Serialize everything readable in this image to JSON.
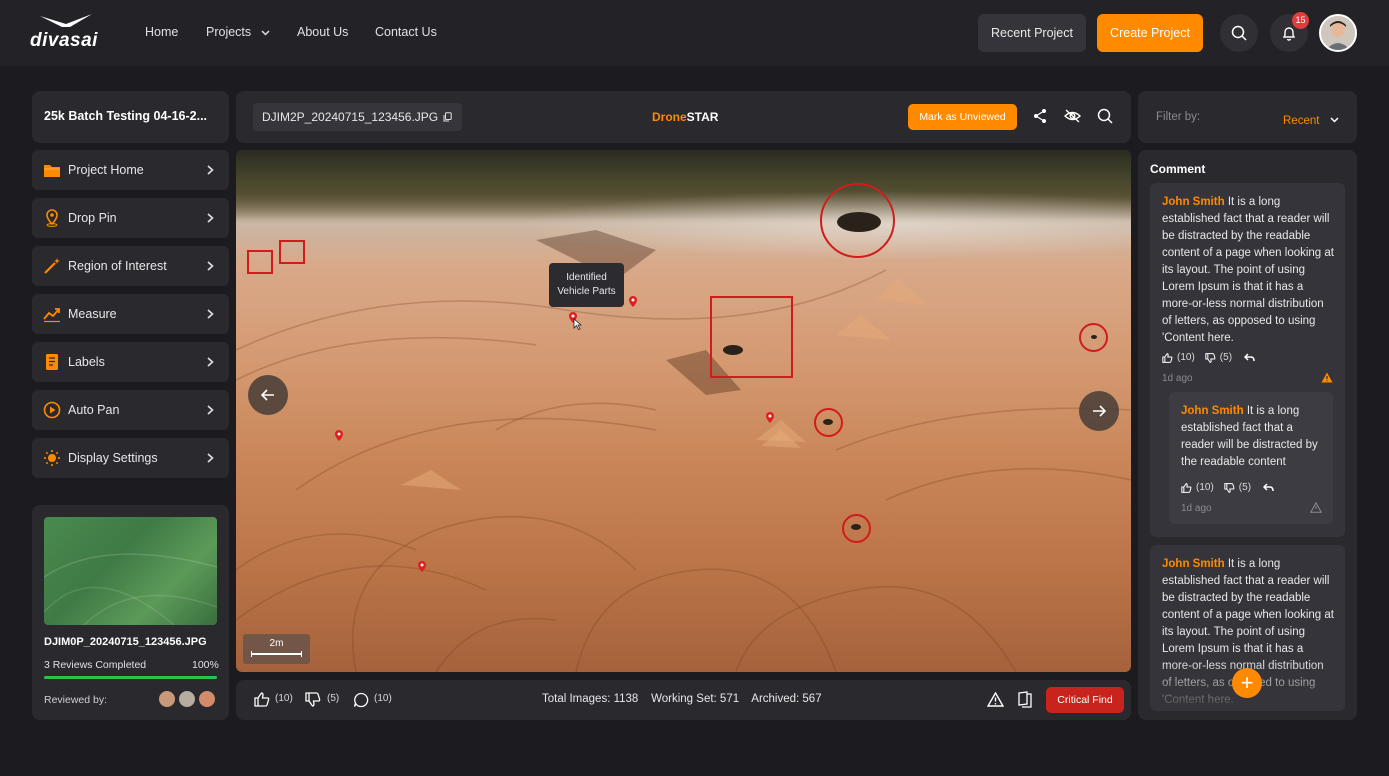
{
  "brand": {
    "name": "divasai"
  },
  "nav": {
    "home": "Home",
    "projects": "Projects",
    "about": "About Us",
    "contact": "Contact Us"
  },
  "header_actions": {
    "recent_project": "Recent Project",
    "create_project": "Create Project",
    "notification_count": "15"
  },
  "sidebar": {
    "project_title": "25k Batch Testing 04-16-2...",
    "items": [
      {
        "label": "Project Home",
        "icon": "folder-icon"
      },
      {
        "label": "Drop Pin",
        "icon": "drop-pin-icon"
      },
      {
        "label": "Region of Interest",
        "icon": "magic-wand-icon"
      },
      {
        "label": "Measure",
        "icon": "trend-icon"
      },
      {
        "label": "Labels",
        "icon": "labels-icon"
      },
      {
        "label": "Auto Pan",
        "icon": "play-icon"
      },
      {
        "label": "Display Settings",
        "icon": "sun-icon"
      }
    ],
    "preview": {
      "file_name": "DJIM0P_20240715_123456.JPG",
      "reviews_label": "3 Reviews Completed",
      "reviews_percent": "100%",
      "progress": 1.0,
      "reviewed_by_label": "Reviewed by:"
    }
  },
  "viewer": {
    "file_name": "DJIM2P_20240715_123456.JPG",
    "title_prefix": "Drone",
    "title_suffix": "STAR",
    "mark_unviewed": "Mark as Unviewed",
    "tooltip": "Identified Vehicle Parts",
    "scale_label": "2m"
  },
  "footer": {
    "likes": "(10)",
    "dislikes": "(5)",
    "comments": "(10)",
    "total_images": "Total Images: 1138",
    "working_set": "Working Set: 571",
    "archived": "Archived: 567",
    "critical_find": "Critical Find"
  },
  "comments_panel": {
    "filter_label": "Filter by:",
    "filter_value": "Recent",
    "title": "Comment",
    "comments": [
      {
        "author": "John Smith",
        "text": " It is a long established fact that a reader will be distracted by the readable content of a page when looking at its layout. The point of using Lorem Ipsum is that it has a more-or-less normal distribution of letters, as opposed to using 'Content here.",
        "likes": "(10)",
        "dislikes": "(5)",
        "time": "1d ago"
      },
      {
        "author": "John Smith",
        "text": " It is a long established fact that a reader will be distracted by the readable content",
        "likes": "(10)",
        "dislikes": "(5)",
        "time": "1d ago"
      },
      {
        "author": "John Smith",
        "text": " It is a long established fact that a reader will be distracted by the readable content of a page when looking at its layout. The point of using Lorem Ipsum is that it has a more-or-less normal distribution of letters, as opposed to using 'Content here."
      }
    ]
  },
  "colors": {
    "accent": "#ff8a00",
    "critical": "#c8241d",
    "annotation": "#d01c1c",
    "progress": "#2bc24a"
  }
}
